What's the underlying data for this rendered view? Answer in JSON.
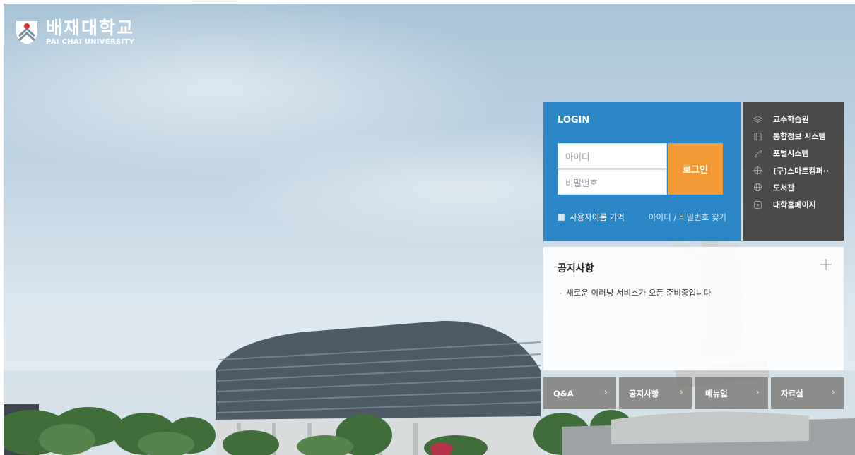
{
  "header": {
    "logo_korean": "배재대학교",
    "logo_english": "PAI CHAI UNIVERSITY"
  },
  "login": {
    "title": "LOGIN",
    "id_placeholder": "아이디",
    "pw_placeholder": "비밀번호",
    "button_label": "로그인",
    "remember_label": "사용자이름 기억",
    "find_label": "아이디 / 비밀번호 찾기"
  },
  "quick_links": {
    "items": [
      {
        "label": "교수학습원",
        "icon": "layers-icon"
      },
      {
        "label": "통합정보 시스템",
        "icon": "book-icon"
      },
      {
        "label": "포털시스템",
        "icon": "link-icon"
      },
      {
        "label": "(구)스마트캠퍼··",
        "icon": "crosshair-icon"
      },
      {
        "label": "도서관",
        "icon": "globe-icon"
      },
      {
        "label": "대학홈페이지",
        "icon": "play-icon"
      }
    ]
  },
  "notice": {
    "title": "공지사항",
    "items": [
      "새로운 이러닝 서비스가 오픈 준비중입니다"
    ]
  },
  "tabs": [
    {
      "label": "Q&A"
    },
    {
      "label": "공지사항"
    },
    {
      "label": "메뉴얼"
    },
    {
      "label": "자료실"
    }
  ],
  "colors": {
    "login_bg": "#2b86c5",
    "login_button": "#f39a34",
    "quick_bg": "#4b4a48"
  }
}
